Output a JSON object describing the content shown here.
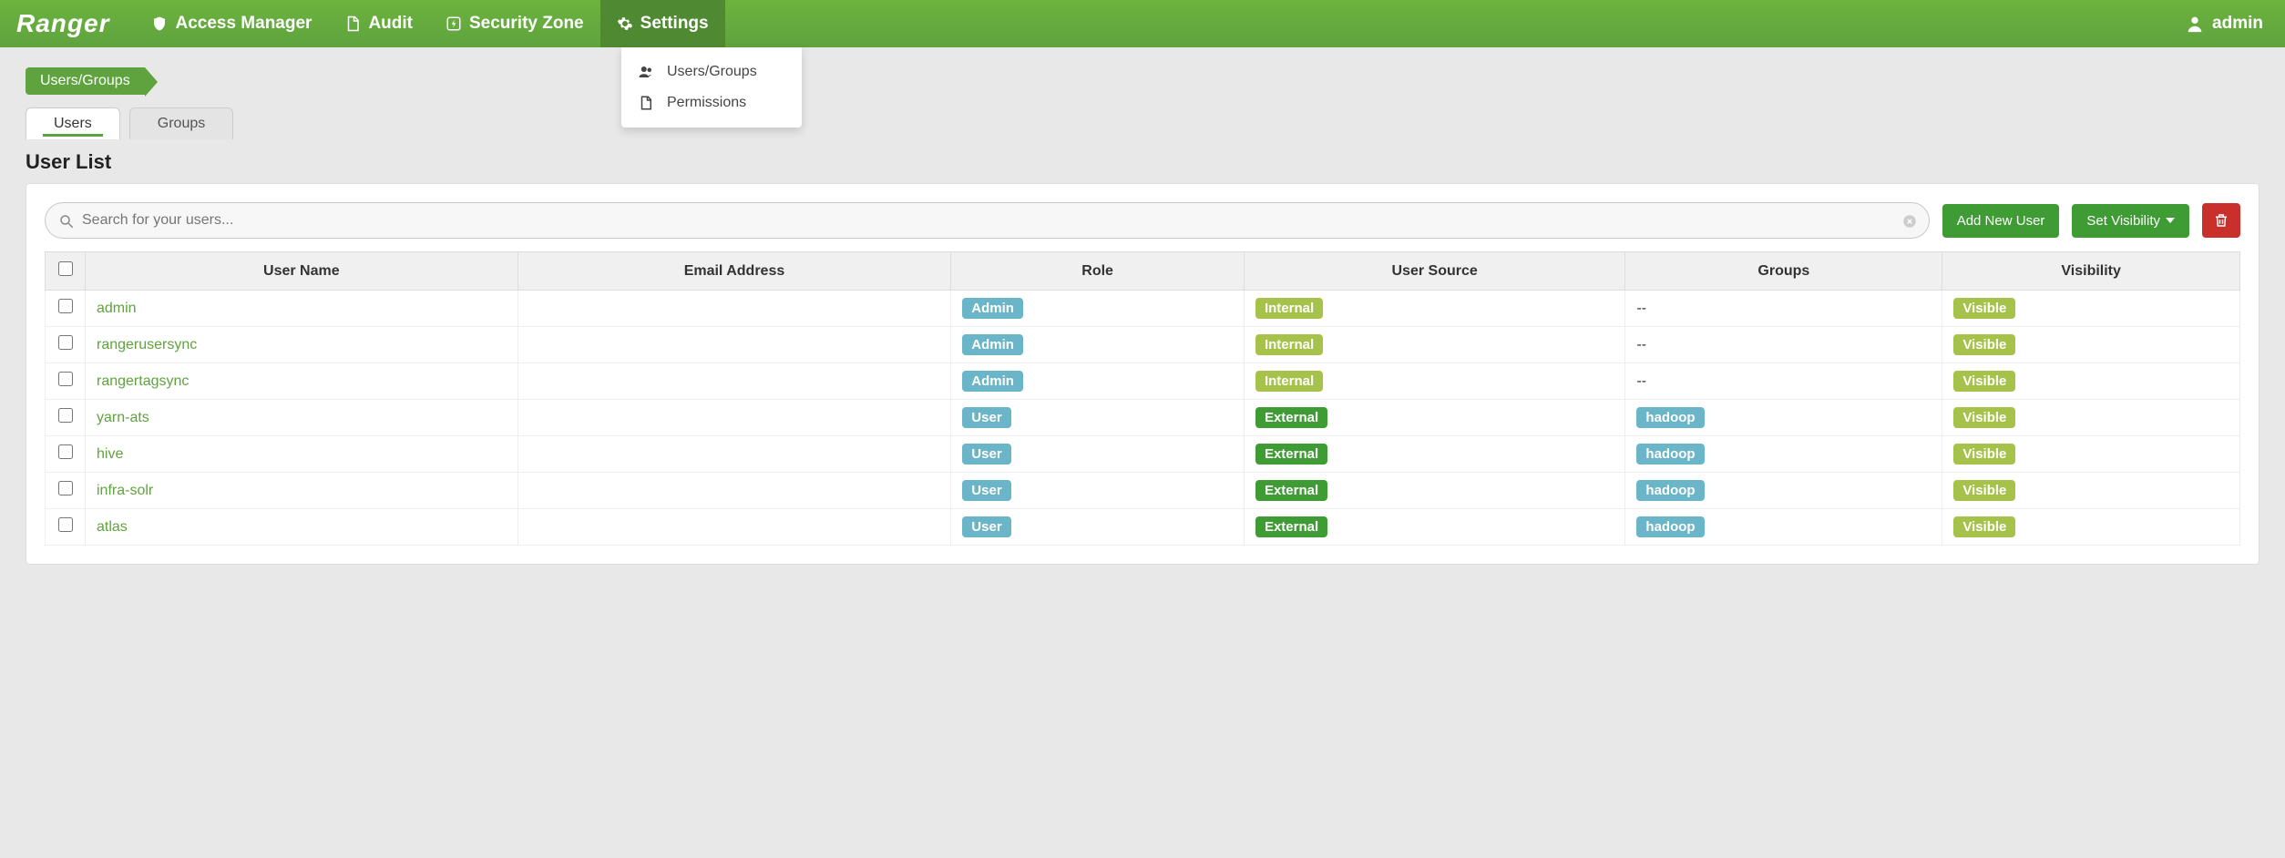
{
  "brand": "Ranger",
  "nav": {
    "access_manager": "Access Manager",
    "audit": "Audit",
    "security_zone": "Security Zone",
    "settings": "Settings"
  },
  "user_label": "admin",
  "dropdown": {
    "users_groups": "Users/Groups",
    "permissions": "Permissions"
  },
  "breadcrumb": "Users/Groups",
  "tabs": {
    "users": "Users",
    "groups": "Groups"
  },
  "page_title": "User List",
  "search": {
    "placeholder": "Search for your users..."
  },
  "buttons": {
    "add_user": "Add New User",
    "set_visibility": "Set Visibility"
  },
  "columns": {
    "user_name": "User Name",
    "email": "Email Address",
    "role": "Role",
    "source": "User Source",
    "groups": "Groups",
    "visibility": "Visibility"
  },
  "rows": [
    {
      "user": "admin",
      "email": "",
      "role": "Admin",
      "role_cls": "teal",
      "src": "Internal",
      "src_cls": "olive",
      "groups": "--",
      "groups_cls": "",
      "vis": "Visible"
    },
    {
      "user": "rangerusersync",
      "email": "",
      "role": "Admin",
      "role_cls": "teal",
      "src": "Internal",
      "src_cls": "olive",
      "groups": "--",
      "groups_cls": "",
      "vis": "Visible"
    },
    {
      "user": "rangertagsync",
      "email": "",
      "role": "Admin",
      "role_cls": "teal",
      "src": "Internal",
      "src_cls": "olive",
      "groups": "--",
      "groups_cls": "",
      "vis": "Visible"
    },
    {
      "user": "yarn-ats",
      "email": "",
      "role": "User",
      "role_cls": "teal",
      "src": "External",
      "src_cls": "green",
      "groups": "hadoop",
      "groups_cls": "teal",
      "vis": "Visible"
    },
    {
      "user": "hive",
      "email": "",
      "role": "User",
      "role_cls": "teal",
      "src": "External",
      "src_cls": "green",
      "groups": "hadoop",
      "groups_cls": "teal",
      "vis": "Visible"
    },
    {
      "user": "infra-solr",
      "email": "",
      "role": "User",
      "role_cls": "teal",
      "src": "External",
      "src_cls": "green",
      "groups": "hadoop",
      "groups_cls": "teal",
      "vis": "Visible"
    },
    {
      "user": "atlas",
      "email": "",
      "role": "User",
      "role_cls": "teal",
      "src": "External",
      "src_cls": "green",
      "groups": "hadoop",
      "groups_cls": "teal",
      "vis": "Visible"
    }
  ]
}
